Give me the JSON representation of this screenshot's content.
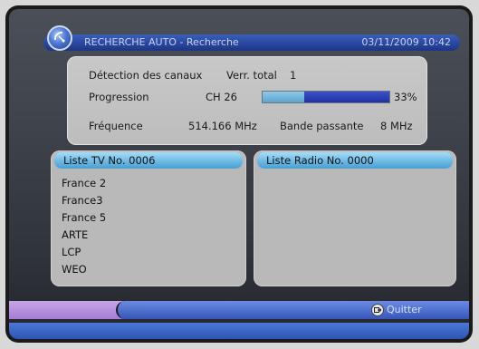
{
  "header": {
    "title": "RECHERCHE AUTO - Recherche",
    "datetime": "03/11/2009 10:42",
    "icon": "satellite-dish-icon"
  },
  "info": {
    "detection_label": "Détection des canaux",
    "lock_label": "Verr. total",
    "lock_value": "1",
    "progress_label": "Progression",
    "progress_channel": "CH 26",
    "progress_percent_text": "33%",
    "progress_fraction": 0.33,
    "frequency_label": "Fréquence",
    "frequency_value": "514.166 MHz",
    "bandwidth_label": "Bande passante",
    "bandwidth_value": "8 MHz"
  },
  "tv_list": {
    "header": "Liste TV No.  0006",
    "channels": [
      "France 2",
      "France3",
      "France 5",
      "ARTE",
      "LCP",
      "WEO"
    ]
  },
  "radio_list": {
    "header": "Liste Radio No.  0000",
    "channels": []
  },
  "footer": {
    "quit_label": "Quitter",
    "quit_icon": "exit-icon"
  },
  "colors": {
    "header_blue": "#2a47a0",
    "list_header_cyan": "#68b6e2",
    "progress_fill": "#5ba6cc",
    "progress_remaining": "#1f31a3",
    "footer_purple": "#a37ed4",
    "footer_blue": "#4a6ccc"
  }
}
